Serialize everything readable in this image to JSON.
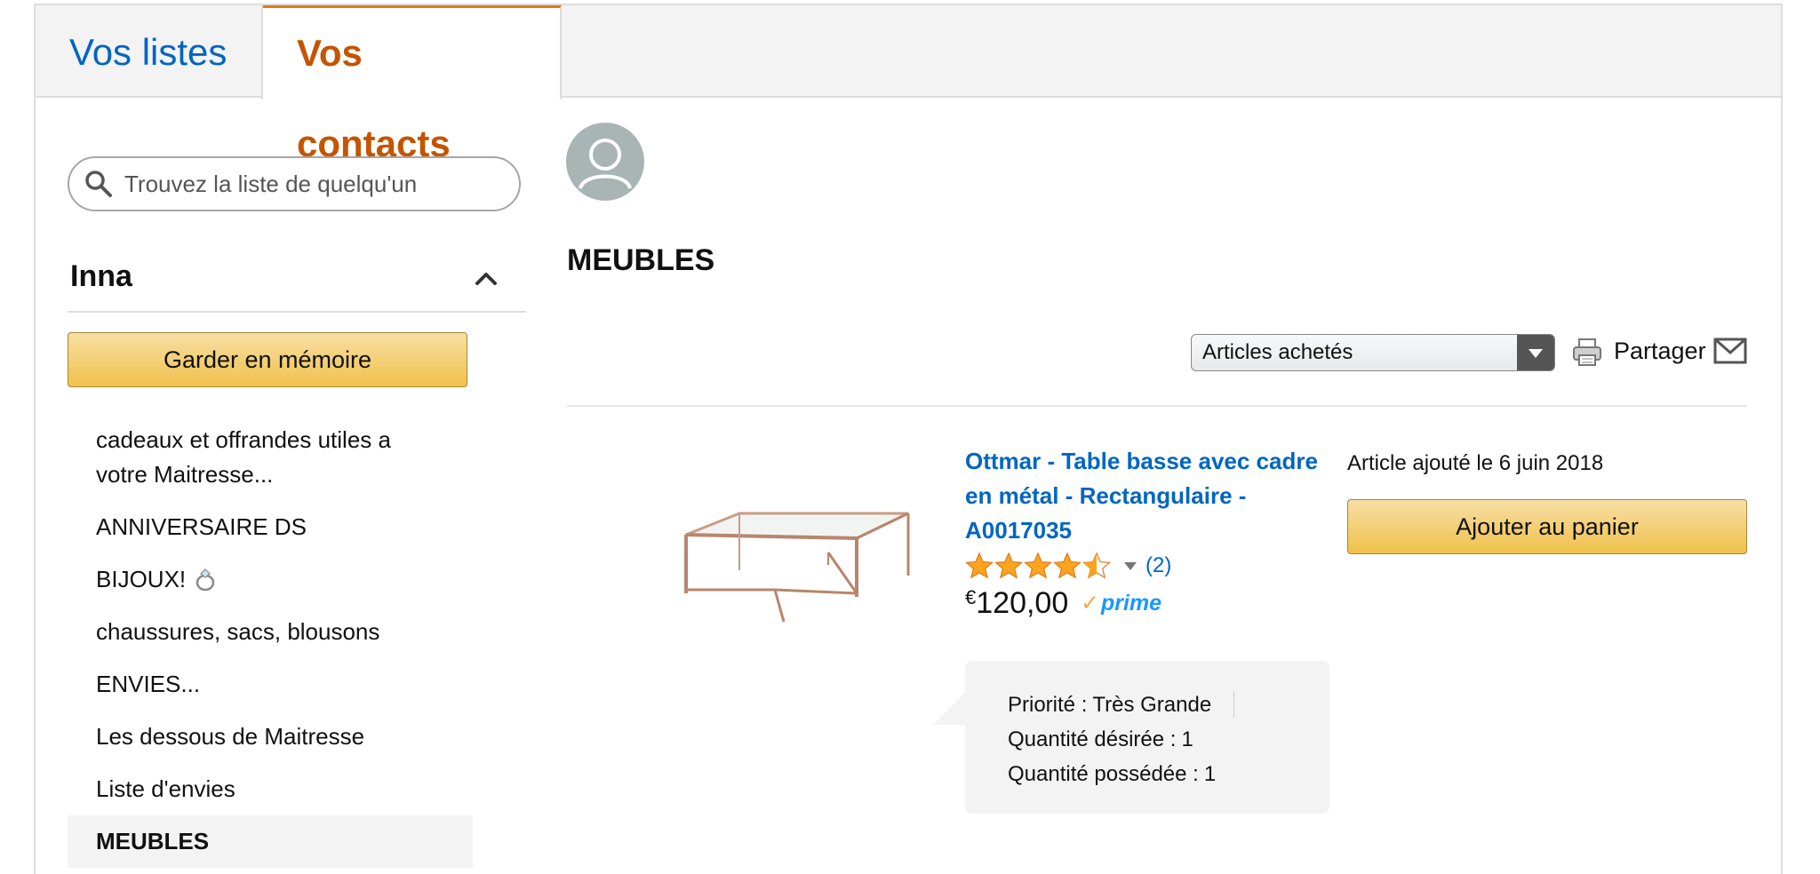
{
  "tabs": [
    {
      "label": "Vos listes"
    },
    {
      "label": "Vos contacts"
    }
  ],
  "sidebar": {
    "search_placeholder": "Trouvez la liste de quelqu'un",
    "owner_name": "Inna",
    "keep_button": "Garder en mémoire",
    "lists": [
      {
        "label": "cadeaux et offrandes utiles a votre Maitresse..."
      },
      {
        "label": "ANNIVERSAIRE DS"
      },
      {
        "label": "BIJOUX!"
      },
      {
        "label": "chaussures, sacs, blousons"
      },
      {
        "label": "ENVIES..."
      },
      {
        "label": "Les dessous de Maitresse"
      },
      {
        "label": "Liste d'envies"
      },
      {
        "label": "MEUBLES"
      }
    ]
  },
  "main": {
    "list_title": "MEUBLES",
    "filter_selected": "Articles achetés",
    "share_label": "Partager",
    "item": {
      "title": "Ottmar - Table basse avec cadre en métal - Rectangulaire - A0017035",
      "rating_stars": 4.5,
      "review_count": "(2)",
      "currency": "€",
      "price": "120,00",
      "prime_label": "prime",
      "added_date": "Article ajouté le 6 juin 2018",
      "add_to_cart": "Ajouter au panier",
      "priority_label": "Priorité :",
      "priority_value": "Très Grande",
      "desired_label": "Quantité désirée :",
      "desired_value": "1",
      "owned_label": "Quantité possédée :",
      "owned_value": "1"
    }
  },
  "colors": {
    "link": "#0066c0",
    "active_tab": "#c45500",
    "button": "#f0c14b",
    "star": "#ffa41c"
  }
}
